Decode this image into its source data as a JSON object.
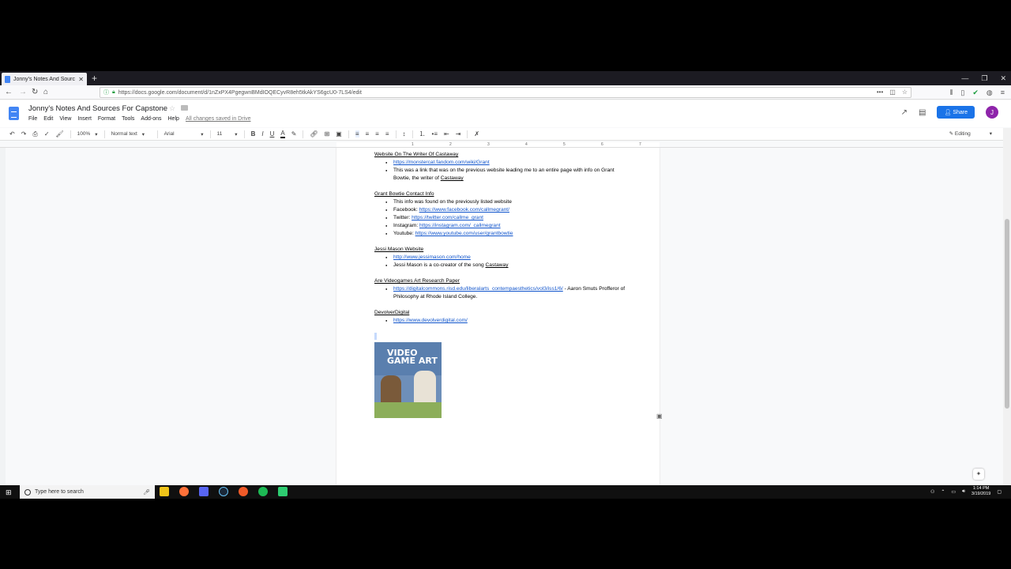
{
  "browser": {
    "tab_title": "Jonny's Notes And Sources For",
    "tab_close": "✕",
    "new_tab": "+",
    "url": "https://docs.google.com/document/d/1nZxPX4PgegwnBMdIOQECyvR8eh5tkAkYS6gcU0-7LS4/edit",
    "window_controls": [
      "—",
      "❐",
      "✕"
    ]
  },
  "docs": {
    "title": "Jonny's Notes And Sources For Capstone",
    "menu": [
      "File",
      "Edit",
      "View",
      "Insert",
      "Format",
      "Tools",
      "Add-ons",
      "Help"
    ],
    "saved_status": "All changes saved in Drive",
    "share_label": "Share",
    "avatar_letter": "J",
    "toolbar": {
      "zoom": "100%",
      "style": "Normal text",
      "font": "Arial",
      "size": "11",
      "mode": "Editing"
    },
    "ruler_numbers": [
      "1",
      "1",
      "2",
      "3",
      "4",
      "5",
      "6",
      "7"
    ]
  },
  "document": {
    "sections": [
      {
        "heading": "Website On The Writer Of Castaway",
        "bullets": [
          {
            "link": "https://monstercat.fandom.com/wiki/Grant"
          },
          {
            "text_before": "This was a link that was on the previous website leading me to an entire page with info on Grant Bowtie, the writer of ",
            "underlined": "Castaway"
          }
        ]
      },
      {
        "heading": "Grant Bowtie Contact Info",
        "bullets": [
          {
            "text_before": "This info was found on the previously listed website"
          },
          {
            "text_before": "Facebook: ",
            "link": "https://www.facebook.com/callmegrant/"
          },
          {
            "text_before": "Twitter: ",
            "link": "https://twitter.com/callme_grant"
          },
          {
            "text_before": "Instagram: ",
            "link": "https://instagram.com/_callmegrant"
          },
          {
            "text_before": "Youtube: ",
            "link": "https://www.youtube.com/user/grantbowtie"
          }
        ]
      },
      {
        "heading": "Jessi Mason Website",
        "bullets": [
          {
            "link": "http://www.jessimason.com/home"
          },
          {
            "text_before": "Jessi Mason is a co-creator of the song ",
            "underlined": "Castaway"
          }
        ]
      },
      {
        "heading": "Are Videogames Art Research Paper",
        "bullets": [
          {
            "link": "https://digitalcommons.risd.edu/liberalarts_contempaesthetics/vol3/iss1/6/",
            "text_after": " - Aaron Smuts Profferor of Philosophy at Rhode Island College."
          }
        ]
      },
      {
        "heading": "DevolverDigital",
        "bullets": [
          {
            "link": "https://www.devolverdigital.com/"
          }
        ]
      }
    ],
    "image_text": "VIDEO GAME ART"
  },
  "taskbar": {
    "search_placeholder": "Type here to search",
    "time": "1:14 PM",
    "date": "3/19/2019",
    "app_colors": [
      "#f0c419",
      "#ff7139",
      "#5865f2",
      "#1b2838",
      "#f05a28",
      "#1db954",
      "#2ecc71"
    ]
  }
}
